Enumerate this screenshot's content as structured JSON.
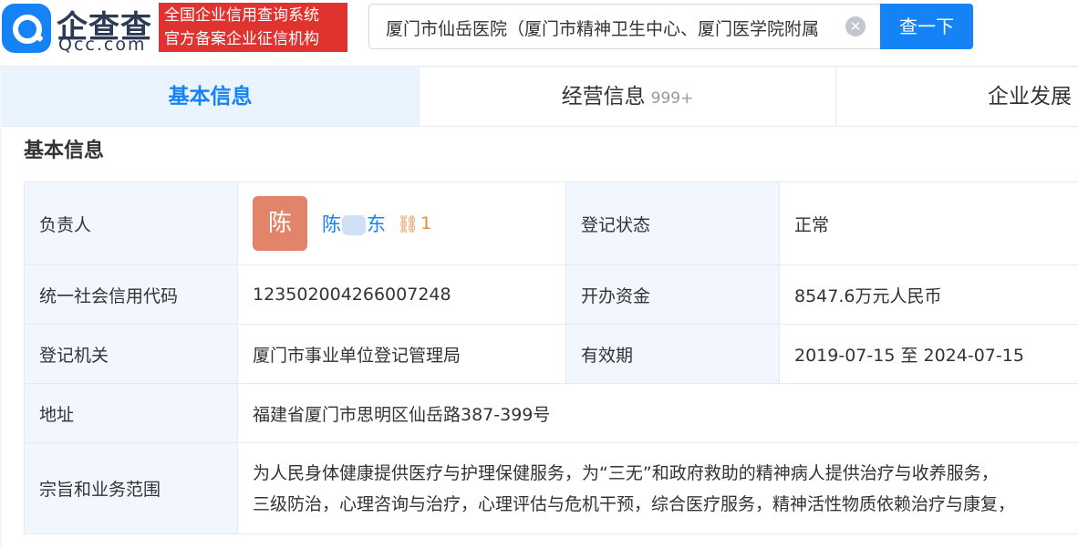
{
  "header": {
    "logo_cn": "企查查",
    "logo_en": "Qcc.com",
    "badge_line1": "全国企业信用查询系统",
    "badge_line2": "官方备案企业征信机构",
    "search_value": "厦门市仙岳医院（厦门市精神卫生中心、厦门医学院附属",
    "search_button": "查一下",
    "colors": {
      "brand": "#1582f5",
      "badge": "#e0322f"
    }
  },
  "tabs": [
    {
      "label": "基本信息",
      "active": true
    },
    {
      "label": "经营信息",
      "count": "999+"
    },
    {
      "label": "企业发展"
    }
  ],
  "section": {
    "title": "基本信息",
    "rows": {
      "person_label": "负责人",
      "avatar_char": "陈",
      "person_name_a": "陈",
      "person_name_b": "东",
      "relation_count": "1",
      "status_label": "登记状态",
      "status_value": "正常",
      "credit_label": "统一社会信用代码",
      "credit_value": "12350200426600724​8",
      "capital_label": "开办资金",
      "capital_value": "8547.6万元人民币",
      "authority_label": "登记机关",
      "authority_value": "厦门市事业单位登记管理局",
      "validity_label": "有效期",
      "validity_value": "2019-07-15 至 2024-07-15",
      "address_label": "地址",
      "address_value": "福建省厦门市思明区仙岳路387-399号",
      "scope_label": "宗旨和业务范围",
      "scope_line1": "为人民身体健康提供医疗与护理保健服务，为“三无”和政府救助的精神病人提供治疗与收养服务，",
      "scope_line2": "三级防治，心理咨询与治疗，心理评估与危机干预，综合医疗服务，精神活性物质依赖治疗与康复，"
    }
  }
}
